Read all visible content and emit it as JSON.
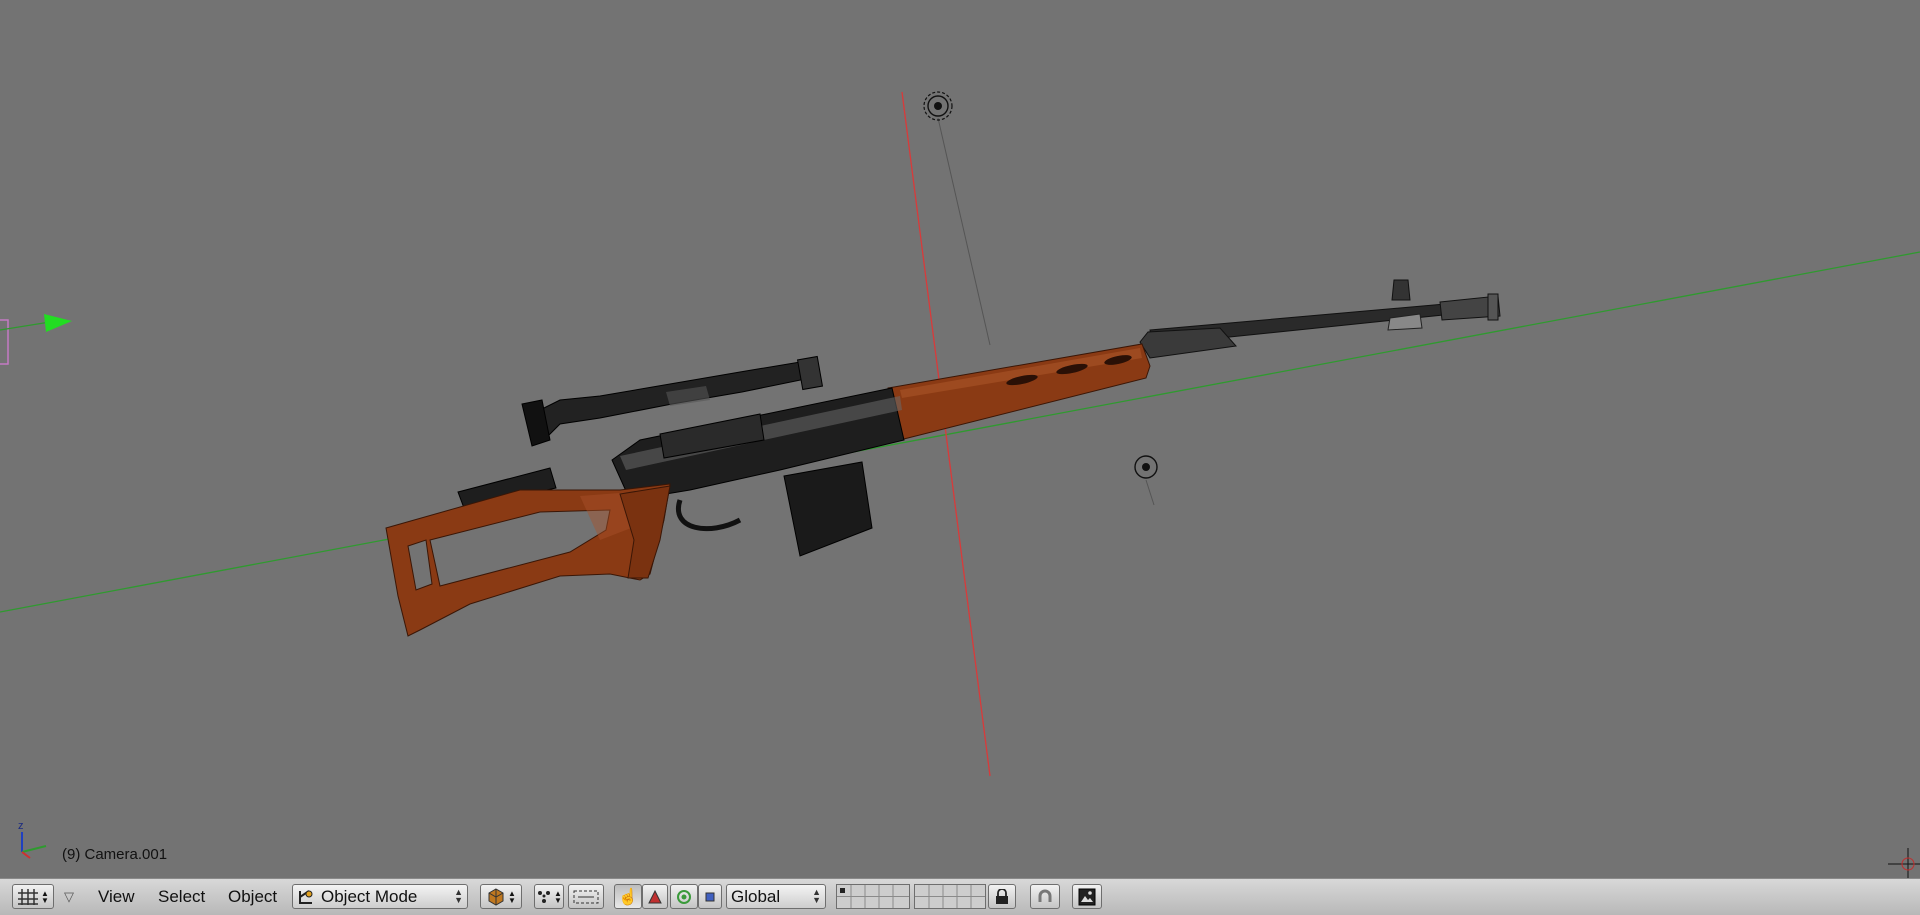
{
  "viewport": {
    "object_info": "(9) Camera.001",
    "axis_label": "z"
  },
  "header": {
    "menus": {
      "view": "View",
      "select": "Select",
      "object": "Object"
    },
    "mode": {
      "selected": "Object Mode"
    },
    "orientation": {
      "selected": "Global"
    }
  },
  "colors": {
    "viewport_bg": "#737373",
    "x_axis": "#e03030",
    "y_axis": "#30a030",
    "wood": "#8a3a14",
    "metal": "#1c1c1c"
  }
}
